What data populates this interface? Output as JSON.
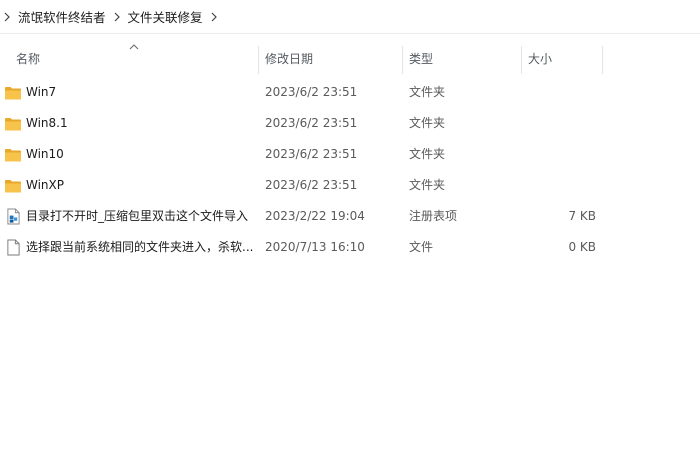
{
  "breadcrumb": {
    "items": [
      {
        "label": "流氓软件终结者"
      },
      {
        "label": "文件关联修复"
      }
    ]
  },
  "columns": {
    "name": "名称",
    "date": "修改日期",
    "type": "类型",
    "size": "大小",
    "sort_column": "name",
    "sort_direction": "ascending"
  },
  "colors": {
    "folder": "#f7c34b",
    "folder_dark": "#e8a92a",
    "reg_icon": "#1e73be"
  },
  "files": [
    {
      "icon": "folder-icon",
      "name": "Win7",
      "date": "2023/6/2 23:51",
      "type": "文件夹",
      "size": ""
    },
    {
      "icon": "folder-icon",
      "name": "Win8.1",
      "date": "2023/6/2 23:51",
      "type": "文件夹",
      "size": ""
    },
    {
      "icon": "folder-icon",
      "name": "Win10",
      "date": "2023/6/2 23:51",
      "type": "文件夹",
      "size": ""
    },
    {
      "icon": "folder-icon",
      "name": "WinXP",
      "date": "2023/6/2 23:51",
      "type": "文件夹",
      "size": ""
    },
    {
      "icon": "registry-file-icon",
      "name": "目录打不开时_压缩包里双击这个文件导入",
      "date": "2023/2/22 19:04",
      "type": "注册表项",
      "size": "7 KB"
    },
    {
      "icon": "blank-file-icon",
      "name": "选择跟当前系统相同的文件夹进入，杀软...",
      "date": "2020/7/13 16:10",
      "type": "文件",
      "size": "0 KB"
    }
  ]
}
